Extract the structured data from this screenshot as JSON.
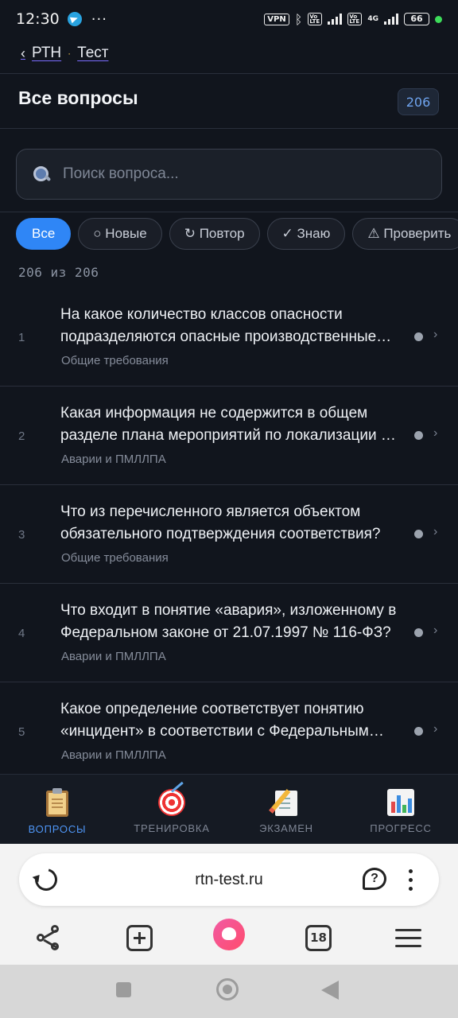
{
  "status_bar": {
    "time": "12:30",
    "dots": "···",
    "vpn": "VPN",
    "volte1": "Vo LTE",
    "volte2": "Vo LTE",
    "net": "4G",
    "battery": "66"
  },
  "breadcrumb": {
    "back": "‹",
    "parent": "РТН",
    "separator": "·",
    "current": "Тест"
  },
  "header": {
    "title": "Все вопросы",
    "count": "206"
  },
  "search": {
    "placeholder": "Поиск вопроса...",
    "value": ""
  },
  "filters": [
    {
      "label": "Все",
      "active": true
    },
    {
      "label": "○ Новые"
    },
    {
      "label": "↻ Повтор"
    },
    {
      "label": "✓ Знаю"
    },
    {
      "label": "⚠ Проверить"
    }
  ],
  "filter_count": "206 из 206",
  "questions": [
    {
      "num": "1",
      "text": "На какое количество классов опасности подразделяются опасные производственные объекты?",
      "category": "Общие требования"
    },
    {
      "num": "2",
      "text": "Какая информация не содержится в общем разделе плана мероприятий по локализации и ликвидации последствий аварий?",
      "category": "Аварии и ПМЛЛПА"
    },
    {
      "num": "3",
      "text": "Что из перечисленного является объектом обязательного подтверждения соответствия?",
      "category": "Общие требования"
    },
    {
      "num": "4",
      "text": "Что входит в понятие «авария», изложенному в Федеральном законе от 21.07.1997 № 116-ФЗ?",
      "category": "Аварии и ПМЛЛПА"
    },
    {
      "num": "5",
      "text": "Какое определение соответствует понятию «инцидент» в соответствии с Федеральным законом?",
      "category": "Аварии и ПМЛЛПА"
    }
  ],
  "bottom_nav": [
    {
      "label": "ВОПРОСЫ",
      "icon": "clipboard-icon",
      "active": true
    },
    {
      "label": "ТРЕНИРОВКА",
      "icon": "target-icon"
    },
    {
      "label": "ЭКЗАМЕН",
      "icon": "memo-icon"
    },
    {
      "label": "ПРОГРЕСС",
      "icon": "bar-chart-icon"
    }
  ],
  "browser": {
    "url": "rtn-test.ru",
    "tabs_count": "18",
    "assistant_glyph": "?"
  },
  "colors": {
    "accent": "#2f86f6",
    "background": "#11151d",
    "badge_text": "#6fa4ef"
  }
}
